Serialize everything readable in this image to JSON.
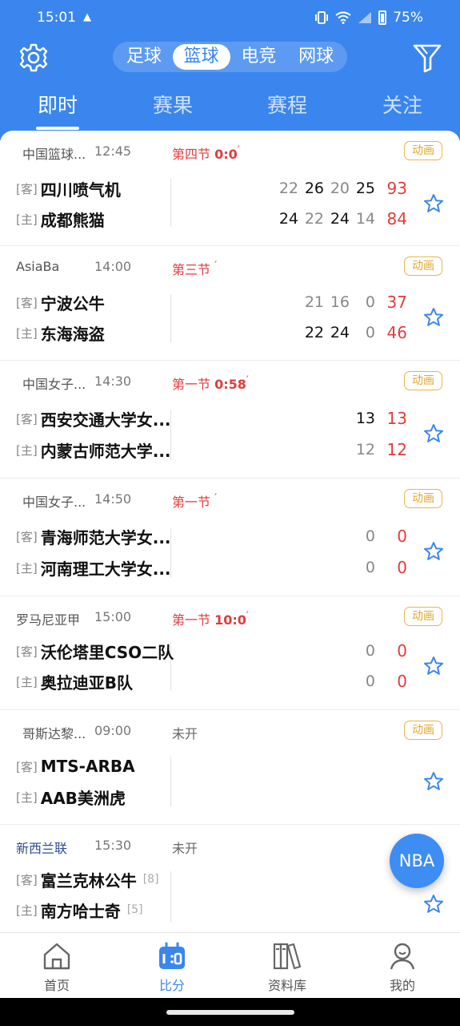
{
  "status_bar": {
    "time": "15:01",
    "alert": "▲",
    "battery": "75%"
  },
  "sport_tabs": [
    "足球",
    "篮球",
    "电竞",
    "网球"
  ],
  "sport_tab_active": 1,
  "main_tabs": [
    "即时",
    "赛果",
    "赛程",
    "关注"
  ],
  "main_tab_active": 0,
  "matches": [
    {
      "league": "中国篮球...",
      "time": "12:45",
      "status": "第四节",
      "clock": "0:0",
      "tick": "′",
      "anim": "动画",
      "away": {
        "tag": "[客]",
        "name": "四川喷气机",
        "quarters": [
          "22",
          "26",
          "20",
          "25"
        ],
        "total": "93"
      },
      "home": {
        "tag": "[主]",
        "name": "成都熊猫",
        "quarters": [
          "24",
          "22",
          "24",
          "14"
        ],
        "total": "84"
      }
    },
    {
      "league": "AsiaBa",
      "time": "14:00",
      "status": "第三节",
      "clock": "",
      "tick": "′",
      "anim": "动画",
      "away": {
        "tag": "[客]",
        "name": "宁波公牛",
        "quarters": [
          "21",
          "16",
          "0"
        ],
        "total": "37"
      },
      "home": {
        "tag": "[主]",
        "name": "东海海盗",
        "quarters": [
          "22",
          "24",
          "0"
        ],
        "total": "46"
      }
    },
    {
      "league": "中国女子...",
      "time": "14:30",
      "status": "第一节",
      "clock": "0:58",
      "tick": "′",
      "anim": "动画",
      "away": {
        "tag": "[客]",
        "name": "西安交通大学女...",
        "quarters": [
          "13"
        ],
        "total": "13"
      },
      "home": {
        "tag": "[主]",
        "name": "内蒙古师范大学...",
        "quarters": [
          "12"
        ],
        "total": "12"
      }
    },
    {
      "league": "中国女子...",
      "time": "14:50",
      "status": "第一节",
      "clock": "",
      "tick": "′",
      "anim": "动画",
      "away": {
        "tag": "[客]",
        "name": "青海师范大学女...",
        "quarters": [
          "0"
        ],
        "total": "0"
      },
      "home": {
        "tag": "[主]",
        "name": "河南理工大学女...",
        "quarters": [
          "0"
        ],
        "total": "0"
      }
    },
    {
      "league": "罗马尼亚甲",
      "time": "15:00",
      "status": "第一节",
      "clock": "10:0",
      "tick": "′",
      "anim": "动画",
      "away": {
        "tag": "[客]",
        "name": "沃伦塔里CSO二队",
        "quarters": [
          "0"
        ],
        "total": "0"
      },
      "home": {
        "tag": "[主]",
        "name": "奥拉迪亚B队",
        "quarters": [
          "0"
        ],
        "total": "0"
      }
    },
    {
      "league": "哥斯达黎...",
      "time": "09:00",
      "status": "未开",
      "clock": "",
      "tick": "",
      "anim": "动画",
      "away": {
        "tag": "[客]",
        "name": "MTS-ARBA",
        "quarters": [],
        "total": ""
      },
      "home": {
        "tag": "[主]",
        "name": "AAB美洲虎",
        "quarters": [],
        "total": ""
      }
    },
    {
      "league": "新西兰联",
      "time": "15:30",
      "status": "未开",
      "clock": "",
      "tick": "",
      "anim": "",
      "away": {
        "tag": "[客]",
        "name": "富兰克林公牛",
        "rank": "[8]",
        "quarters": [],
        "total": ""
      },
      "home": {
        "tag": "[主]",
        "name": "南方哈士奇",
        "rank": "[5]",
        "quarters": [],
        "total": ""
      }
    }
  ],
  "fab_label": "NBA",
  "bottom_nav": [
    "首页",
    "比分",
    "资料库",
    "我的"
  ],
  "bottom_nav_active": 1,
  "colors": {
    "brand": "#3a86ee",
    "score_red": "#e33b3b",
    "anim_gold": "#e4a52e"
  }
}
